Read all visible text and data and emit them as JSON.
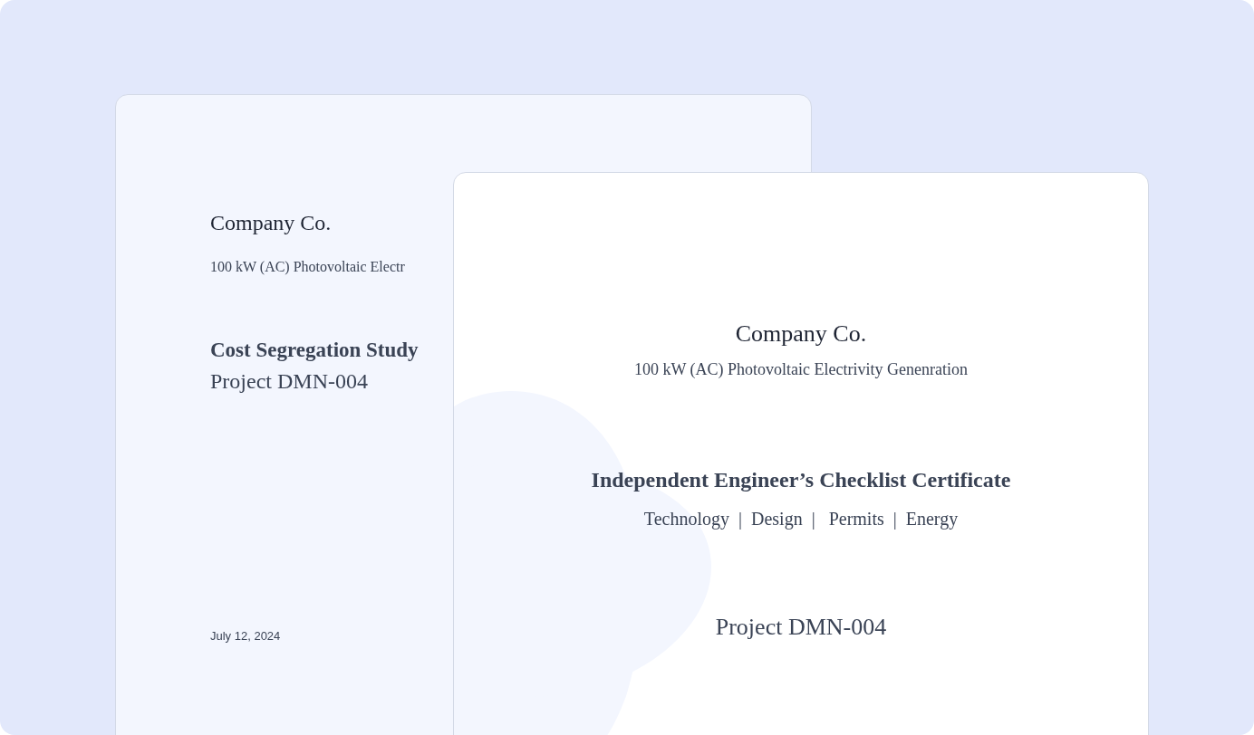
{
  "back_document": {
    "company": "Company Co.",
    "subtitle": "100 kW (AC) Photovoltaic Electr",
    "title": "Cost Segregation Study",
    "project": "Project DMN-004",
    "date": "July 12, 2024"
  },
  "front_document": {
    "company": "Company Co.",
    "subtitle": "100 kW (AC) Photovoltaic Electrivity Genenration",
    "title": "Independent Engineer’s Checklist Certificate",
    "tags": "Technology  |  Design  |   Permits  |  Energy",
    "project": "Project DMN-004"
  }
}
